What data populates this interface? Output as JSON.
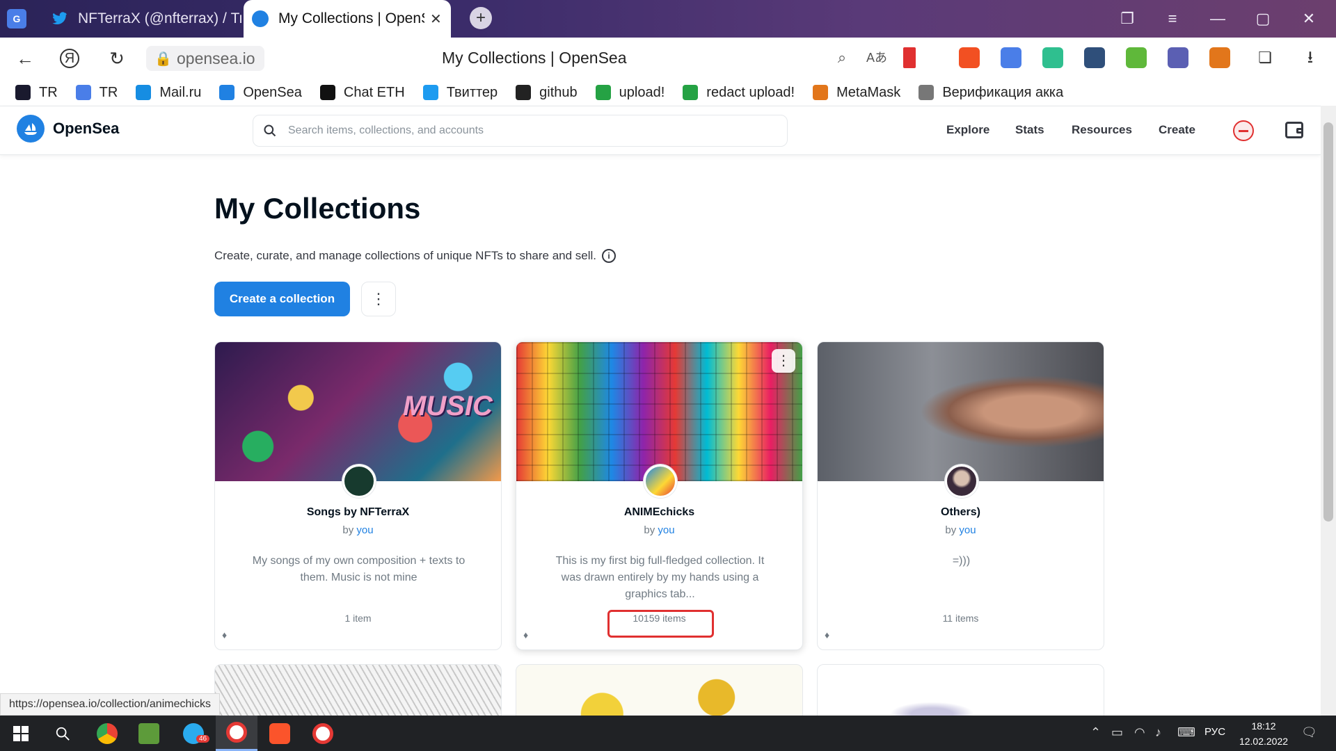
{
  "browser": {
    "tabs": [
      {
        "title": "NFTerraX (@nfterrax) / Твиттер"
      },
      {
        "title": "My Collections | OpenSea"
      }
    ],
    "address": "opensea.io",
    "page_title": "My Collections | OpenSea",
    "bookmarks": [
      {
        "label": "TR",
        "icon": "tr-icon",
        "color": "#1a1a2e"
      },
      {
        "label": "TR",
        "icon": "translate-icon",
        "color": "#4a7ee8"
      },
      {
        "label": "Mail.ru",
        "icon": "mailru-icon",
        "color": "#168de2"
      },
      {
        "label": "OpenSea",
        "icon": "opensea-icon",
        "color": "#2081e2"
      },
      {
        "label": "Chat ETH",
        "icon": "chat-eth-icon",
        "color": "#111111"
      },
      {
        "label": "Твиттер",
        "icon": "twitter-icon",
        "color": "#1d9bf0"
      },
      {
        "label": "github",
        "icon": "github-icon",
        "color": "#222222"
      },
      {
        "label": "upload!",
        "icon": "upload-icon",
        "color": "#25a244"
      },
      {
        "label": "redact upload!",
        "icon": "redact-upload-icon",
        "color": "#25a244"
      },
      {
        "label": "MetaMask",
        "icon": "metamask-icon",
        "color": "#e2761b"
      },
      {
        "label": "Верификация акка",
        "icon": "verification-icon",
        "color": "#777777"
      }
    ]
  },
  "header": {
    "logo": "OpenSea",
    "search_placeholder": "Search items, collections, and accounts",
    "nav": [
      "Explore",
      "Stats",
      "Resources",
      "Create"
    ]
  },
  "main": {
    "title": "My Collections",
    "subtitle": "Create, curate, and manage collections of unique NFTs to share and sell.",
    "create_button": "Create a collection",
    "more_glyph": "⋮",
    "by_label": "by",
    "you_label": "you",
    "eth_glyph": "♦",
    "collections": [
      {
        "name": "Songs by NFTerraX",
        "description": "My songs of my own composition + texts to them. Music is not mine",
        "count": "1 item"
      },
      {
        "name": "ANIMEchicks",
        "description": "This is my first big full-fledged collection. It was drawn entirely by my hands using a graphics tab...",
        "count": "10159 items"
      },
      {
        "name": "Others)",
        "description": "=)))",
        "count": "11 items"
      }
    ]
  },
  "status_url": "https://opensea.io/collection/animechicks",
  "taskbar": {
    "lang": "РУС",
    "time": "18:12",
    "date": "12.02.2022",
    "telegram_badge": "46"
  },
  "colors": {
    "accent": "#2081e2",
    "highlight": "#e03030"
  }
}
